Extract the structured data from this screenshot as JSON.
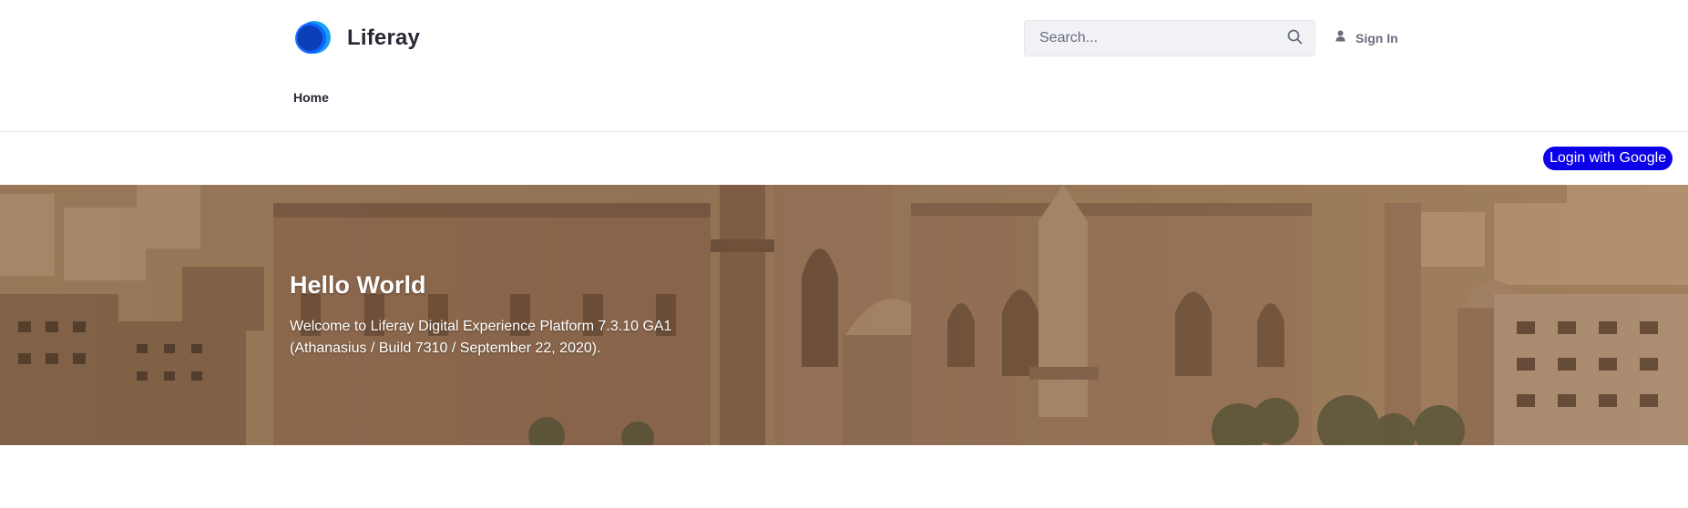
{
  "header": {
    "brand_name": "Liferay",
    "logo_icon": "liferay-logo",
    "search": {
      "placeholder": "Search...",
      "value": "",
      "icon": "search-icon"
    },
    "sign_in": {
      "label": "Sign In",
      "icon": "user-icon"
    }
  },
  "nav": {
    "items": [
      {
        "label": "Home"
      }
    ]
  },
  "google_login": {
    "label": "Login with Google"
  },
  "banner": {
    "title": "Hello World",
    "text_line1": "Welcome to Liferay Digital Experience Platform 7.3.10 GA1",
    "text_line2": "(Athanasius / Build 7310 / September 22, 2020)."
  },
  "colors": {
    "accent_blue": "#0b5fff",
    "google_button": "#0b00e8",
    "banner_tone": "#9c7558"
  }
}
